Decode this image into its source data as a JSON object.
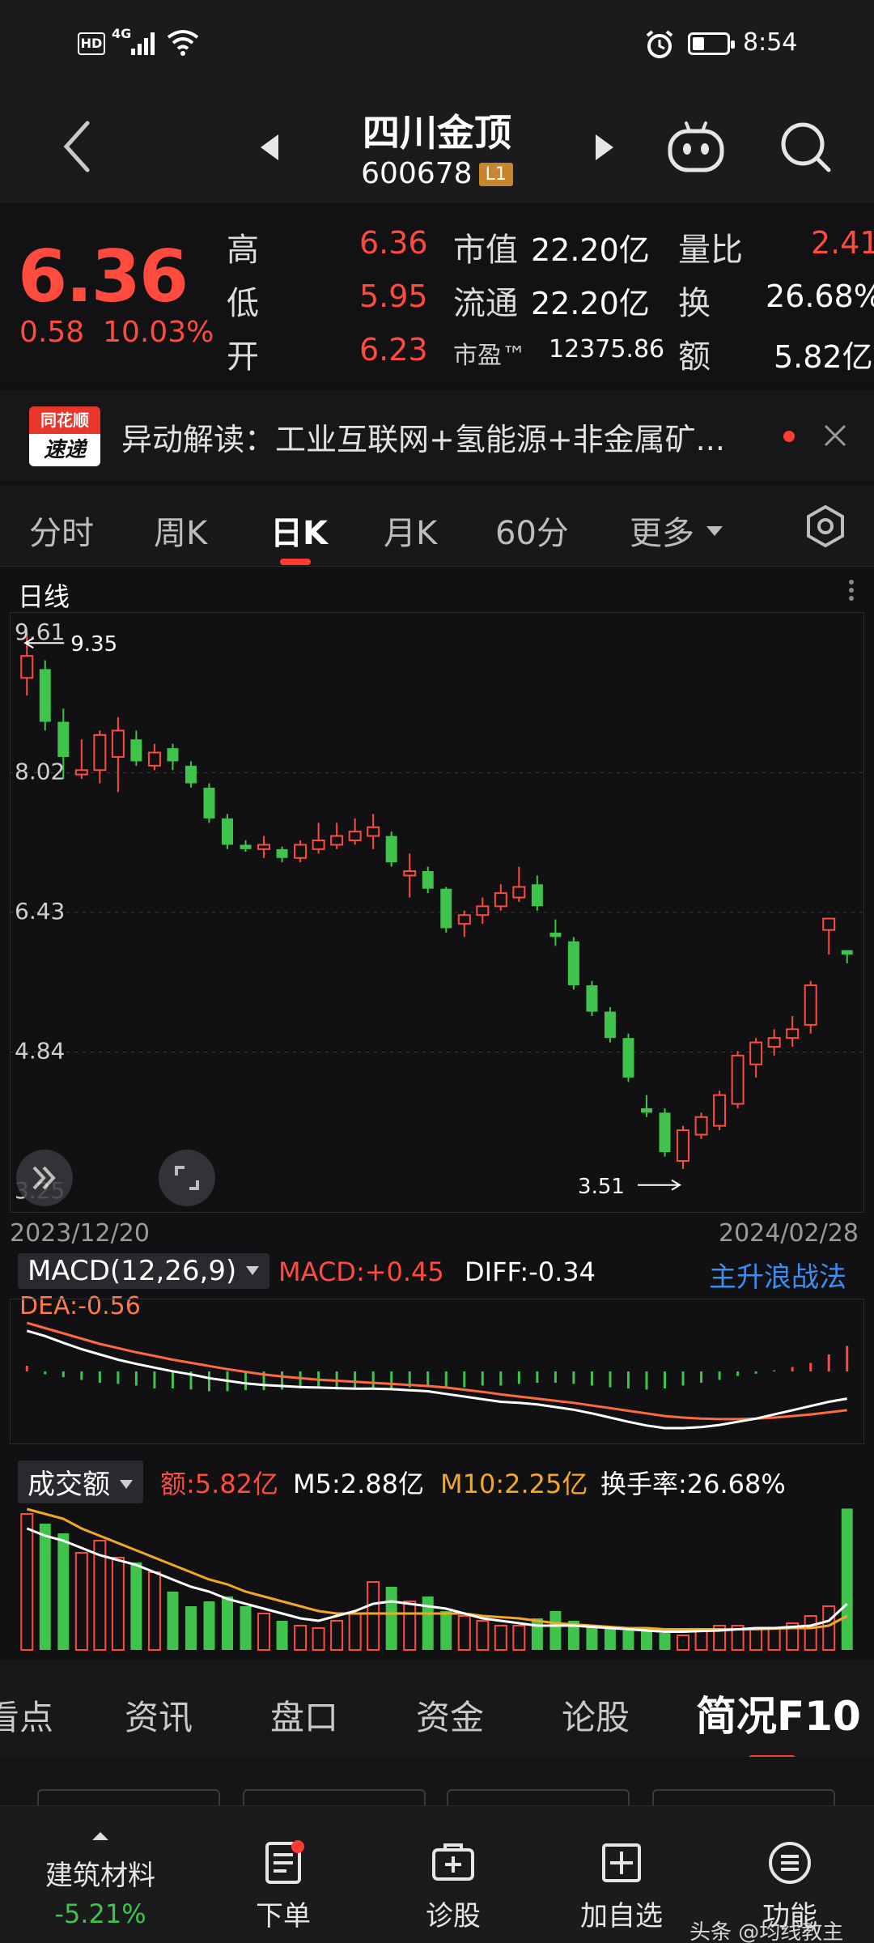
{
  "status_bar": {
    "time": "8:54",
    "network": "4G",
    "hd": "HD"
  },
  "header": {
    "name": "四川金顶",
    "code": "600678",
    "badge": "L1"
  },
  "quote": {
    "price": "6.36",
    "change": "0.58",
    "change_pct": "10.03%",
    "high_label": "高",
    "high": "6.36",
    "low_label": "低",
    "low": "5.95",
    "open_label": "开",
    "open": "6.23",
    "mktcap_label": "市值",
    "mktcap": "22.20亿",
    "float_label": "流通",
    "float": "22.20亿",
    "pe_label": "市盈™",
    "pe": "12375.86",
    "vol_ratio_label": "量比",
    "vol_ratio": "2.41",
    "turnover_label": "换",
    "turnover": "26.68%",
    "amount_label": "额",
    "amount": "5.82亿"
  },
  "news": {
    "logo_top": "同花顺",
    "logo_bottom": "速递",
    "text": "异动解读：工业互联网+氢能源+非金属矿..."
  },
  "ktabs": [
    {
      "label": "分时"
    },
    {
      "label": "周K"
    },
    {
      "label": "日K"
    },
    {
      "label": "月K"
    },
    {
      "label": "60分"
    },
    {
      "label": "更多"
    }
  ],
  "chart": {
    "title": "日线",
    "price_ticks": [
      "9.61",
      "8.02",
      "6.43",
      "4.84",
      "3.25"
    ],
    "high_marker": "9.35",
    "low_marker": "3.51",
    "date_start": "2023/12/20",
    "date_end": "2024/02/28"
  },
  "macd": {
    "label": "MACD(12,26,9)",
    "macd": "MACD:+0.45",
    "diff": "DIFF:-0.34",
    "dea": "DEA:-0.56",
    "strategy": "主升浪战法"
  },
  "volume": {
    "label": "成交额",
    "amount": "额:5.82亿",
    "m5": "M5:2.88亿",
    "m10": "M10:2.25亿",
    "turnover": "换手率:26.68%"
  },
  "btabs": [
    {
      "label": "看点"
    },
    {
      "label": "资讯"
    },
    {
      "label": "盘口"
    },
    {
      "label": "资金"
    },
    {
      "label": "论股"
    },
    {
      "label": "简况F10"
    }
  ],
  "navbar": {
    "sector_name": "建筑材料",
    "sector_change": "-5.21%",
    "items": [
      {
        "label": "下单"
      },
      {
        "label": "诊股"
      },
      {
        "label": "加自选"
      },
      {
        "label": "功能"
      }
    ]
  },
  "watermark": "头条 @均线教主",
  "colors": {
    "up": "#ff4b3e",
    "down": "#3fc34a",
    "accent": "#ff3b30",
    "blue": "#3b8df0",
    "orange": "#f5a623"
  },
  "chart_data": {
    "type": "candlestick",
    "price_range": [
      3.25,
      9.61
    ],
    "candles": [
      {
        "o": 9.1,
        "c": 9.35,
        "h": 9.61,
        "l": 8.9
      },
      {
        "o": 9.2,
        "c": 8.6,
        "h": 9.3,
        "l": 8.5
      },
      {
        "o": 8.6,
        "c": 8.2,
        "h": 8.75,
        "l": 7.95
      },
      {
        "o": 8.0,
        "c": 8.05,
        "h": 8.4,
        "l": 7.95
      },
      {
        "o": 8.05,
        "c": 8.45,
        "h": 8.5,
        "l": 7.9
      },
      {
        "o": 8.2,
        "c": 8.5,
        "h": 8.65,
        "l": 7.8
      },
      {
        "o": 8.4,
        "c": 8.15,
        "h": 8.5,
        "l": 8.1
      },
      {
        "o": 8.1,
        "c": 8.25,
        "h": 8.35,
        "l": 8.05
      },
      {
        "o": 8.3,
        "c": 8.15,
        "h": 8.35,
        "l": 8.05
      },
      {
        "o": 8.1,
        "c": 7.9,
        "h": 8.15,
        "l": 7.85
      },
      {
        "o": 7.85,
        "c": 7.5,
        "h": 7.9,
        "l": 7.45
      },
      {
        "o": 7.5,
        "c": 7.2,
        "h": 7.55,
        "l": 7.15
      },
      {
        "o": 7.2,
        "c": 7.15,
        "h": 7.25,
        "l": 7.12
      },
      {
        "o": 7.15,
        "c": 7.2,
        "h": 7.3,
        "l": 7.05
      },
      {
        "o": 7.15,
        "c": 7.05,
        "h": 7.18,
        "l": 7.0
      },
      {
        "o": 7.05,
        "c": 7.2,
        "h": 7.25,
        "l": 7.0
      },
      {
        "o": 7.15,
        "c": 7.25,
        "h": 7.45,
        "l": 7.1
      },
      {
        "o": 7.2,
        "c": 7.3,
        "h": 7.45,
        "l": 7.15
      },
      {
        "o": 7.25,
        "c": 7.35,
        "h": 7.5,
        "l": 7.2
      },
      {
        "o": 7.3,
        "c": 7.4,
        "h": 7.55,
        "l": 7.15
      },
      {
        "o": 7.3,
        "c": 7.0,
        "h": 7.35,
        "l": 6.95
      },
      {
        "o": 6.85,
        "c": 6.9,
        "h": 7.1,
        "l": 6.6
      },
      {
        "o": 6.9,
        "c": 6.7,
        "h": 6.95,
        "l": 6.65
      },
      {
        "o": 6.7,
        "c": 6.25,
        "h": 6.72,
        "l": 6.2
      },
      {
        "o": 6.3,
        "c": 6.4,
        "h": 6.45,
        "l": 6.15
      },
      {
        "o": 6.4,
        "c": 6.5,
        "h": 6.6,
        "l": 6.3
      },
      {
        "o": 6.5,
        "c": 6.65,
        "h": 6.75,
        "l": 6.45
      },
      {
        "o": 6.6,
        "c": 6.72,
        "h": 6.95,
        "l": 6.55
      },
      {
        "o": 6.75,
        "c": 6.5,
        "h": 6.85,
        "l": 6.45
      },
      {
        "o": 6.2,
        "c": 6.15,
        "h": 6.35,
        "l": 6.05
      },
      {
        "o": 6.1,
        "c": 5.6,
        "h": 6.15,
        "l": 5.55
      },
      {
        "o": 5.6,
        "c": 5.3,
        "h": 5.65,
        "l": 5.25
      },
      {
        "o": 5.3,
        "c": 5.0,
        "h": 5.35,
        "l": 4.95
      },
      {
        "o": 5.0,
        "c": 4.55,
        "h": 5.05,
        "l": 4.5
      },
      {
        "o": 4.2,
        "c": 4.15,
        "h": 4.35,
        "l": 4.1
      },
      {
        "o": 4.15,
        "c": 3.7,
        "h": 4.2,
        "l": 3.65
      },
      {
        "o": 3.6,
        "c": 3.95,
        "h": 4.0,
        "l": 3.51
      },
      {
        "o": 3.9,
        "c": 4.1,
        "h": 4.15,
        "l": 3.85
      },
      {
        "o": 4.0,
        "c": 4.35,
        "h": 4.4,
        "l": 3.95
      },
      {
        "o": 4.25,
        "c": 4.8,
        "h": 4.85,
        "l": 4.2
      },
      {
        "o": 4.7,
        "c": 4.95,
        "h": 5.0,
        "l": 4.55
      },
      {
        "o": 4.9,
        "c": 5.0,
        "h": 5.1,
        "l": 4.8
      },
      {
        "o": 5.0,
        "c": 5.1,
        "h": 5.25,
        "l": 4.9
      },
      {
        "o": 5.15,
        "c": 5.6,
        "h": 5.65,
        "l": 5.05
      },
      {
        "o": 6.23,
        "c": 6.36,
        "h": 6.36,
        "l": 5.95
      },
      {
        "o": 6.0,
        "c": 5.95,
        "h": 6.0,
        "l": 5.85
      }
    ],
    "macd_hist": [
      0.1,
      -0.05,
      -0.1,
      -0.15,
      -0.2,
      -0.22,
      -0.25,
      -0.3,
      -0.3,
      -0.32,
      -0.35,
      -0.35,
      -0.33,
      -0.33,
      -0.32,
      -0.3,
      -0.3,
      -0.32,
      -0.3,
      -0.3,
      -0.3,
      -0.28,
      -0.28,
      -0.3,
      -0.28,
      -0.25,
      -0.25,
      -0.22,
      -0.2,
      -0.2,
      -0.22,
      -0.25,
      -0.28,
      -0.3,
      -0.32,
      -0.3,
      -0.25,
      -0.2,
      -0.15,
      -0.08,
      -0.04,
      0.02,
      0.08,
      0.15,
      0.3,
      0.45
    ],
    "diff": [
      0.95,
      0.85,
      0.72,
      0.6,
      0.5,
      0.4,
      0.32,
      0.25,
      0.18,
      0.12,
      0.05,
      0.0,
      -0.05,
      -0.08,
      -0.1,
      -0.12,
      -0.13,
      -0.14,
      -0.15,
      -0.15,
      -0.16,
      -0.18,
      -0.2,
      -0.25,
      -0.3,
      -0.35,
      -0.4,
      -0.42,
      -0.45,
      -0.5,
      -0.55,
      -0.62,
      -0.7,
      -0.78,
      -0.85,
      -0.9,
      -0.9,
      -0.88,
      -0.84,
      -0.78,
      -0.72,
      -0.64,
      -0.56,
      -0.48,
      -0.4,
      -0.34
    ],
    "dea": [
      1.1,
      1.0,
      0.9,
      0.8,
      0.7,
      0.62,
      0.54,
      0.47,
      0.4,
      0.34,
      0.28,
      0.22,
      0.17,
      0.12,
      0.08,
      0.05,
      0.02,
      0.0,
      -0.02,
      -0.04,
      -0.06,
      -0.08,
      -0.1,
      -0.13,
      -0.17,
      -0.21,
      -0.26,
      -0.3,
      -0.34,
      -0.38,
      -0.42,
      -0.47,
      -0.52,
      -0.57,
      -0.62,
      -0.67,
      -0.7,
      -0.72,
      -0.73,
      -0.73,
      -0.72,
      -0.7,
      -0.67,
      -0.64,
      -0.6,
      -0.56
    ],
    "amount": [
      5.6,
      5.2,
      4.8,
      4.0,
      4.5,
      3.8,
      3.6,
      3.2,
      2.4,
      1.8,
      2.0,
      2.2,
      1.8,
      1.5,
      1.2,
      1.0,
      0.9,
      1.2,
      1.5,
      2.8,
      2.6,
      2.0,
      2.2,
      1.6,
      1.4,
      1.2,
      1.0,
      1.0,
      1.3,
      1.6,
      1.2,
      1.0,
      0.9,
      0.8,
      0.9,
      0.7,
      0.6,
      0.8,
      1.0,
      1.0,
      0.9,
      0.9,
      1.1,
      1.4,
      1.8,
      5.82
    ],
    "m5": [
      5.0,
      4.7,
      4.5,
      4.2,
      3.9,
      3.7,
      3.5,
      3.2,
      2.9,
      2.6,
      2.4,
      2.1,
      1.9,
      1.7,
      1.5,
      1.3,
      1.2,
      1.4,
      1.6,
      1.9,
      2.0,
      1.9,
      1.8,
      1.7,
      1.5,
      1.3,
      1.2,
      1.1,
      1.0,
      1.0,
      1.0,
      0.95,
      0.9,
      0.85,
      0.8,
      0.75,
      0.75,
      0.78,
      0.8,
      0.85,
      0.9,
      0.9,
      0.95,
      1.0,
      1.2,
      1.9
    ],
    "m10": [
      5.8,
      5.6,
      5.4,
      5.0,
      4.7,
      4.4,
      4.1,
      3.8,
      3.5,
      3.2,
      2.9,
      2.7,
      2.4,
      2.2,
      2.0,
      1.8,
      1.6,
      1.5,
      1.5,
      1.5,
      1.5,
      1.5,
      1.5,
      1.5,
      1.5,
      1.4,
      1.35,
      1.3,
      1.2,
      1.1,
      1.05,
      1.0,
      0.95,
      0.9,
      0.9,
      0.85,
      0.85,
      0.85,
      0.85,
      0.85,
      0.85,
      0.88,
      0.9,
      0.9,
      1.0,
      1.4
    ]
  }
}
